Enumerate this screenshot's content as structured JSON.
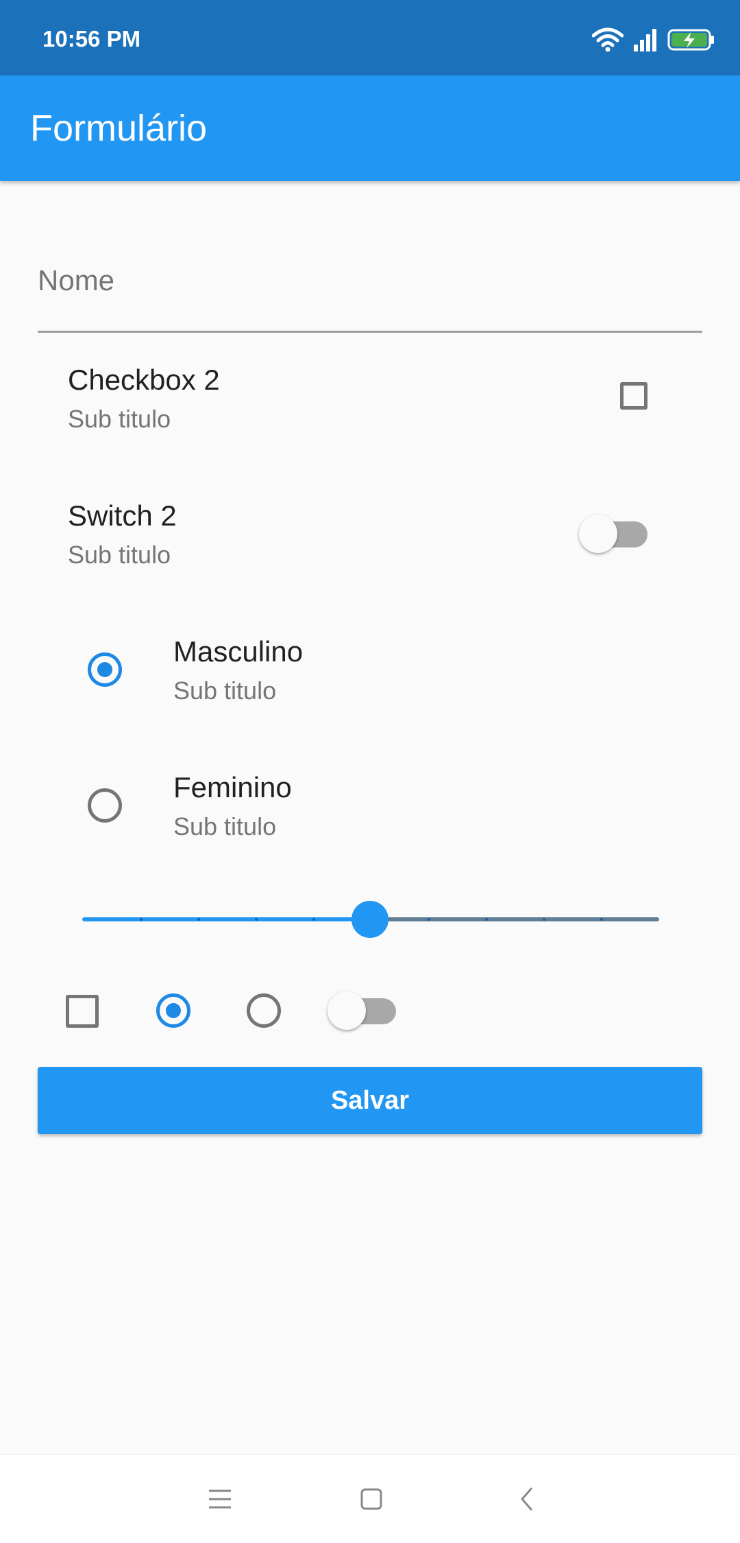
{
  "status_bar": {
    "time": "10:56 PM",
    "icons": [
      "wifi-icon",
      "signal-icon",
      "battery-charging-icon"
    ]
  },
  "app_bar": {
    "title": "Formulário"
  },
  "form": {
    "name_field": {
      "placeholder": "Nome",
      "value": ""
    },
    "checkbox_tile": {
      "title": "Checkbox 2",
      "subtitle": "Sub titulo",
      "checked": false
    },
    "switch_tile": {
      "title": "Switch 2",
      "subtitle": "Sub titulo",
      "on": false
    },
    "radio_tiles": [
      {
        "title": "Masculino",
        "subtitle": "Sub titulo",
        "selected": true
      },
      {
        "title": "Feminino",
        "subtitle": "Sub titulo",
        "selected": false
      }
    ],
    "slider": {
      "value": 5,
      "min": 0,
      "max": 10,
      "divisions": 10
    },
    "inline_controls": {
      "checkbox_checked": false,
      "radio_selected": [
        true,
        false
      ],
      "switch_on": false
    },
    "save_label": "Salvar"
  },
  "nav_bar": {
    "items": [
      "menu-icon",
      "home-square-icon",
      "back-icon"
    ]
  },
  "colors": {
    "status_bar": "#1b72ba",
    "primary": "#2196f3",
    "accent": "#1e88e5",
    "background": "#fafafa"
  }
}
